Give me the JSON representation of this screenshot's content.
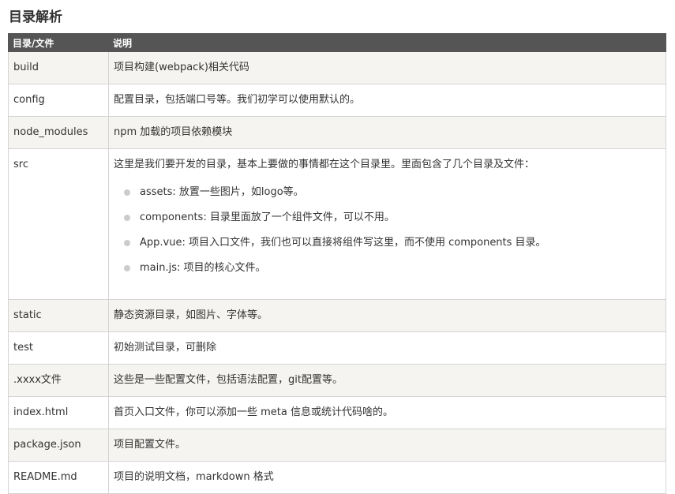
{
  "heading": "目录解析",
  "table": {
    "headers": [
      "目录/文件",
      "说明"
    ],
    "rows": [
      {
        "name": "build",
        "desc": "项目构建(webpack)相关代码"
      },
      {
        "name": "config",
        "desc": "配置目录，包括端口号等。我们初学可以使用默认的。"
      },
      {
        "name": "node_modules",
        "desc": "npm 加载的项目依赖模块"
      },
      {
        "name": "src",
        "desc": "这里是我们要开发的目录，基本上要做的事情都在这个目录里。里面包含了几个目录及文件：",
        "bullets": [
          "assets: 放置一些图片，如logo等。",
          "components: 目录里面放了一个组件文件，可以不用。",
          "App.vue: 项目入口文件，我们也可以直接将组件写这里，而不使用 components 目录。",
          "main.js: 项目的核心文件。"
        ]
      },
      {
        "name": "static",
        "desc": "静态资源目录，如图片、字体等。"
      },
      {
        "name": "test",
        "desc": "初始测试目录，可删除"
      },
      {
        "name": ".xxxx文件",
        "desc": "这些是一些配置文件，包括语法配置，git配置等。"
      },
      {
        "name": "index.html",
        "desc": "首页入口文件，你可以添加一些 meta 信息或统计代码啥的。"
      },
      {
        "name": "package.json",
        "desc": "项目配置文件。"
      },
      {
        "name": "README.md",
        "desc": "项目的说明文档，markdown 格式"
      }
    ]
  }
}
